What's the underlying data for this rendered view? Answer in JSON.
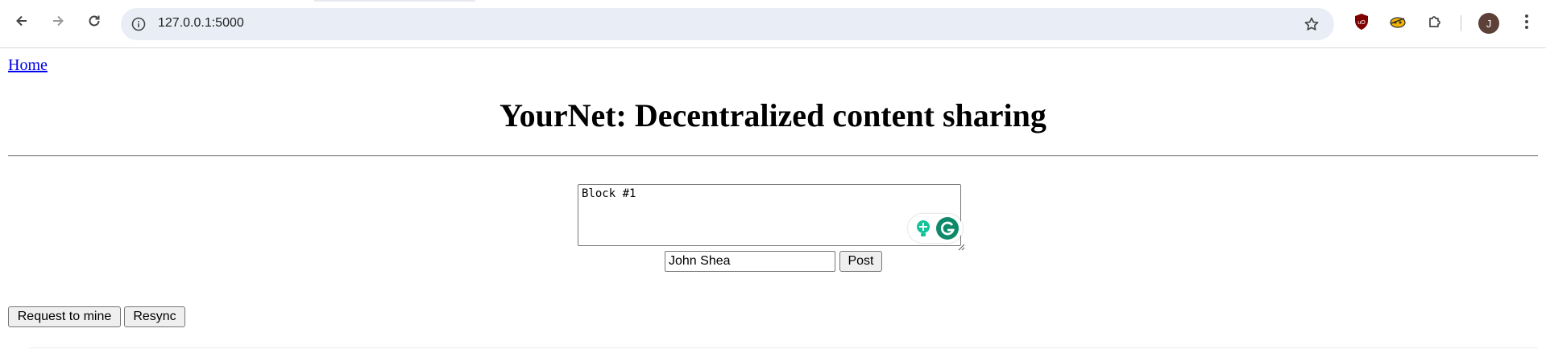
{
  "browser": {
    "url": "127.0.0.1:5000",
    "profile_initial": "J",
    "icons": {
      "back": "arrow-left-icon",
      "forward": "arrow-right-icon",
      "reload": "reload-icon",
      "site_info": "info-icon",
      "bookmark": "star-icon",
      "ext1": "ublock-shield-icon",
      "ext2": "extension-icon",
      "ext3": "puzzle-icon",
      "menu": "kebab-menu-icon"
    }
  },
  "page": {
    "home_link": "Home",
    "title": "YourNet: Decentralized content sharing",
    "post_form": {
      "content_value": "Block #1",
      "author_value": "John Shea",
      "post_label": "Post"
    },
    "actions": {
      "mine_label": "Request to mine",
      "resync_label": "Resync"
    }
  },
  "colors": {
    "link": "#0000ee",
    "omnibox_bg": "#e9edf6",
    "avatar_bg": "#5d4037",
    "ublock_red": "#800000",
    "grammarly_green": "#15c39a"
  }
}
